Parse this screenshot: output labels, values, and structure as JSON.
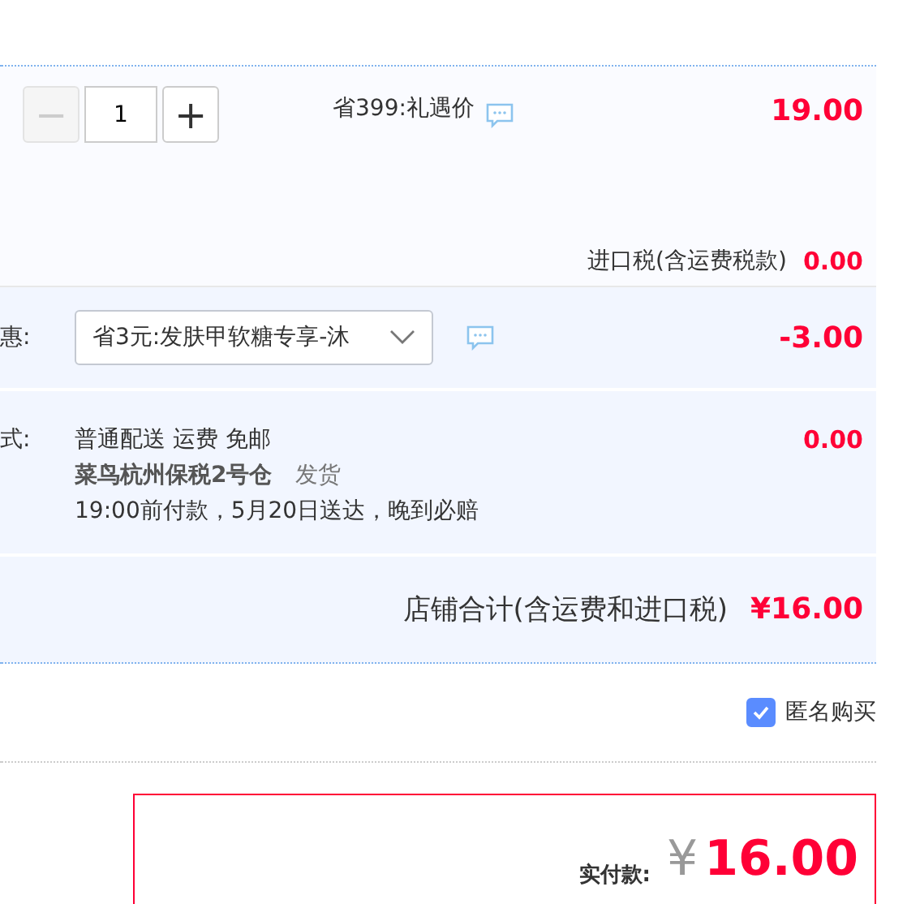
{
  "item": {
    "quantity": "1",
    "minus_disabled": true,
    "minus": "−",
    "plus": "+",
    "promo": "省399:礼遇价",
    "price": "19.00",
    "tax_label": "进口税(含运费税款)",
    "tax": "0.00"
  },
  "discount": {
    "label": "惠:",
    "selected_option": "省3元:发肤甲软糖专享-沐",
    "amount": "-3.00"
  },
  "shipping": {
    "label": "式:",
    "method": "普通配送 运费 免邮",
    "warehouse": "菜鸟杭州保税2号仓",
    "dispatch": "发货",
    "promise": "19:00前付款，5月20日送达，晚到必赔",
    "fee": "0.00"
  },
  "store_total": {
    "label": "店铺合计(含运费和进口税)",
    "amount": "¥16.00"
  },
  "anonymous": {
    "label": "匿名购买",
    "checked": true
  },
  "payment": {
    "label": "实付款:",
    "currency": "¥",
    "amount": "16.00"
  }
}
